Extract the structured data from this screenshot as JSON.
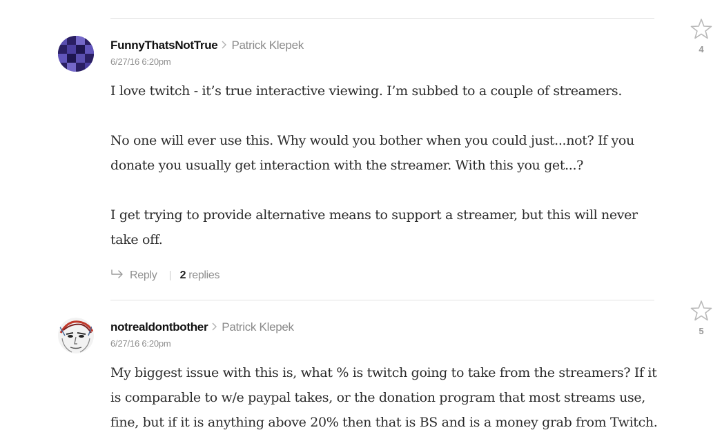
{
  "comments": [
    {
      "author": "FunnyThatsNotTrue",
      "recipient": "Patrick Klepek",
      "timestamp": "6/27/16 6:20pm",
      "paragraphs": [
        "I love twitch - it’s true interactive viewing. I’m subbed to a couple of streamers.",
        "No one will ever use this. Why would you bother when you could just...not? If you donate you usually get interaction with the streamer. With this you get...?",
        "I get trying to provide alternative means to support a streamer, but this will never take off."
      ],
      "reply_label": "Reply",
      "replies_count": "2",
      "replies_label": "replies",
      "stars": "4"
    },
    {
      "author": "notrealdontbother",
      "recipient": "Patrick Klepek",
      "timestamp": "6/27/16 6:20pm",
      "paragraphs": [
        "My biggest issue with this is, what % is twitch going to take from the streamers? If it is comparable to w/e paypal takes, or the donation program that most streams use, fine, but if it is anything above 20% then that is BS and is a money grab from Twitch."
      ],
      "stars": "5"
    }
  ],
  "colors": {
    "avatar1_dark": "#2a1f63",
    "avatar1_light": "#5a4fb0",
    "star_outline": "#b9b9b9"
  },
  "icons": {
    "reply": "reply-arrow-icon",
    "star": "star-outline-icon",
    "chevron": "chevron-right-icon"
  }
}
